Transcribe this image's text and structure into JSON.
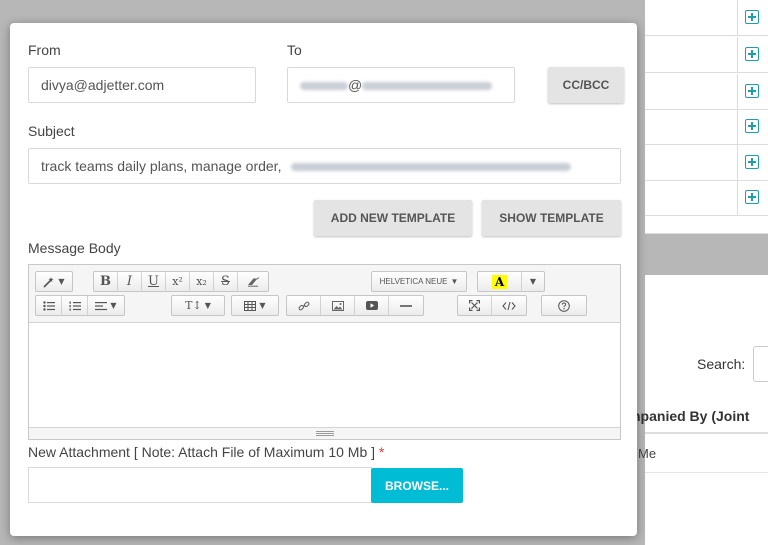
{
  "background": {
    "search_label": "Search:",
    "column_header": "npanied By (Joint",
    "cell_value": "Me",
    "plus_rows": 6
  },
  "modal": {
    "from_label": "From",
    "from_value": "divya@adjetter.com",
    "to_label": "To",
    "to_value_visible": "@",
    "cc_bcc_button": "CC/BCC",
    "subject_label": "Subject",
    "subject_value": "track teams daily plans, manage order,",
    "add_template_button": "ADD NEW TEMPLATE",
    "show_template_button": "SHOW TEMPLATE",
    "message_body_label": "Message Body",
    "toolbar": {
      "bold": "B",
      "italic": "I",
      "underline": "U",
      "superscript": "x²",
      "subscript": "x₂",
      "strikethrough": "S",
      "font_name": "HELVETICA NEUE",
      "font_color": "A",
      "font_size": "T↕"
    },
    "attachment_label": "New Attachment [ Note: Attach File of Maximum 10 Mb ]",
    "required_mark": "*",
    "browse_button": "BROWSE..."
  },
  "colors": {
    "accent": "#00bcd4",
    "required": "#e53935",
    "plus_icon": "#1fa0a8",
    "overlay": "#b7b7b7"
  }
}
